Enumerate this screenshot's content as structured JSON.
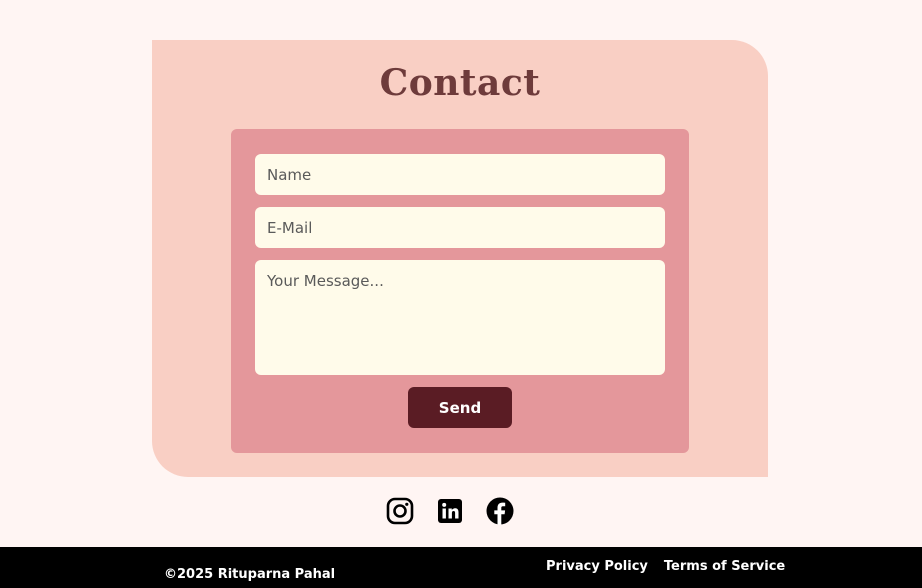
{
  "contact": {
    "title": "Contact"
  },
  "form": {
    "name_placeholder": "Name",
    "email_placeholder": "E-Mail",
    "message_placeholder": "Your Message...",
    "send_label": "Send"
  },
  "social": {
    "icons": [
      "instagram-icon",
      "linkedin-icon",
      "facebook-icon"
    ]
  },
  "footer": {
    "copyright": "©2025 Rituparna Pahal",
    "privacy_label": "Privacy Policy",
    "terms_label": "Terms of Service"
  },
  "colors": {
    "page_background": "#fff5f3",
    "section_background": "#f9cfc4",
    "form_background": "#e4979b",
    "input_background": "#fffbea",
    "button_background": "#5a1c24",
    "title_color": "#6e3b3b",
    "footer_background": "#000000"
  }
}
